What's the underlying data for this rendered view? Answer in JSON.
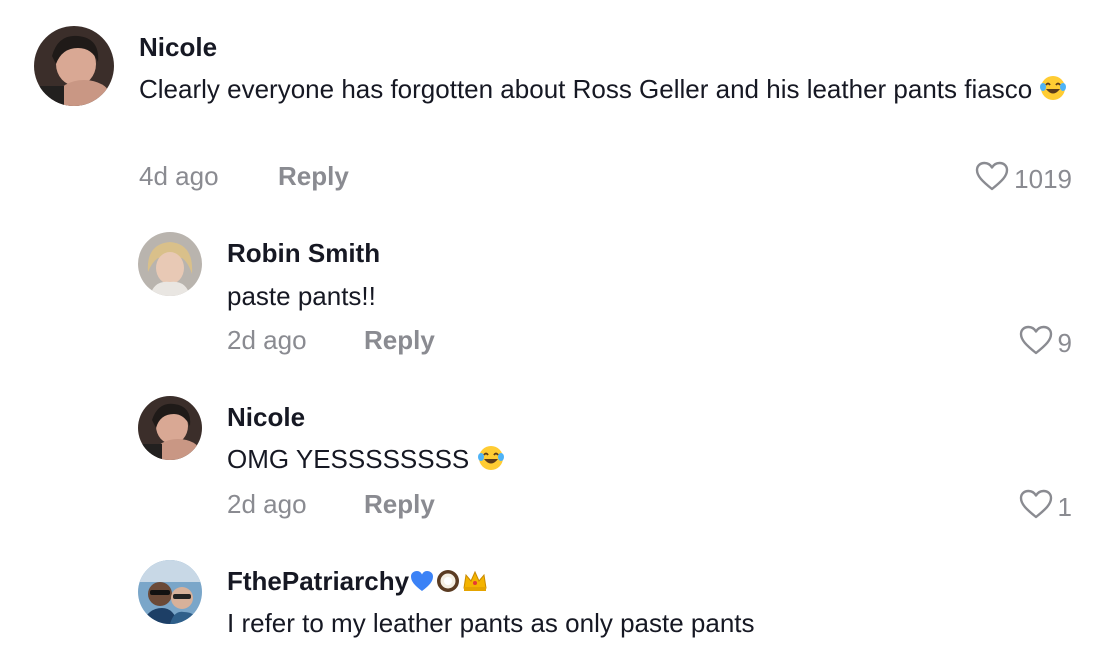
{
  "comments": [
    {
      "username": "Nicole",
      "text": "Clearly everyone has forgotten about Ross Geller and his leather pants fiasco",
      "emoji": "laughing-tears",
      "time": "4d ago",
      "reply": "Reply",
      "likes": "1019"
    },
    {
      "username": "Robin Smith",
      "text": "paste pants!!",
      "time": "2d ago",
      "reply": "Reply",
      "likes": "9"
    },
    {
      "username": "Nicole",
      "text": "OMG YESSSSSSSS",
      "emoji": "laughing-tears",
      "time": "2d ago",
      "reply": "Reply",
      "likes": "1"
    },
    {
      "username": "FthePatriarchy",
      "username_emojis": [
        "blue-heart",
        "coconut",
        "crown"
      ],
      "text": "I refer to my leather pants as only paste pants"
    }
  ],
  "colors": {
    "primary_text": "#161823",
    "secondary_text": "#8a8b91"
  }
}
